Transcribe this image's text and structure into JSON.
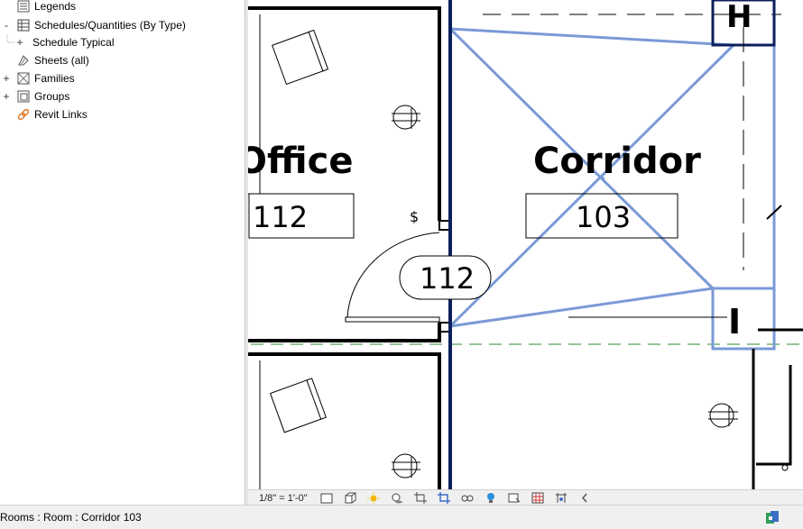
{
  "project_browser": {
    "items": [
      {
        "label": "Legends",
        "icon": "legend-icon"
      },
      {
        "label": "Schedules/Quantities (By Type)",
        "icon": "schedule-icon",
        "expander": "-"
      },
      {
        "label": "Schedule Typical",
        "expander": "+"
      },
      {
        "label": "Sheets (all)",
        "icon": "sheets-icon"
      },
      {
        "label": "Families",
        "icon": "families-icon",
        "expander": "+"
      },
      {
        "label": "Groups",
        "icon": "groups-icon",
        "expander": "+"
      },
      {
        "label": "Revit Links",
        "icon": "revit-links-icon"
      }
    ]
  },
  "drawing": {
    "rooms": [
      {
        "name": "Office",
        "number": "112"
      },
      {
        "name": "Corridor",
        "number": "103"
      }
    ],
    "door_tag": "112",
    "colors": {
      "selection": "#7a9ad6",
      "wall": "#000000",
      "dark_wall": "#0b1f5c",
      "gridline": "#2e8b2e"
    }
  },
  "view_control_bar": {
    "scale": "1/8\" = 1'-0\"",
    "icons": [
      "detail-level-icon",
      "visual-style-icon",
      "sun-path-icon",
      "shadows-icon",
      "crop-view-icon",
      "show-crop-region-icon",
      "temporary-hide-icon",
      "reveal-hidden-icon",
      "analytical-model-icon",
      "highlight-displacement-icon",
      "constraints-icon",
      "collapse-icon"
    ]
  },
  "status_bar": {
    "text": "Rooms : Room : Corridor 103",
    "icon": "worksharing-icon"
  }
}
